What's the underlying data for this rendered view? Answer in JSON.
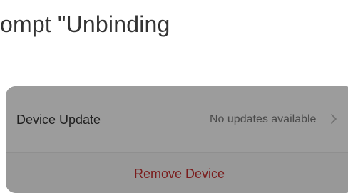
{
  "header": {
    "text": "ompt \"Unbinding"
  },
  "device_settings": {
    "update_row": {
      "label": "Device Update",
      "status": "No updates available",
      "chevron_icon": "chevron-right-icon"
    },
    "remove_button": {
      "label": "Remove Device"
    }
  },
  "colors": {
    "overlay_panel": "#9a9a9a",
    "danger_text": "#7a1c1c",
    "heading_text": "#333333"
  }
}
